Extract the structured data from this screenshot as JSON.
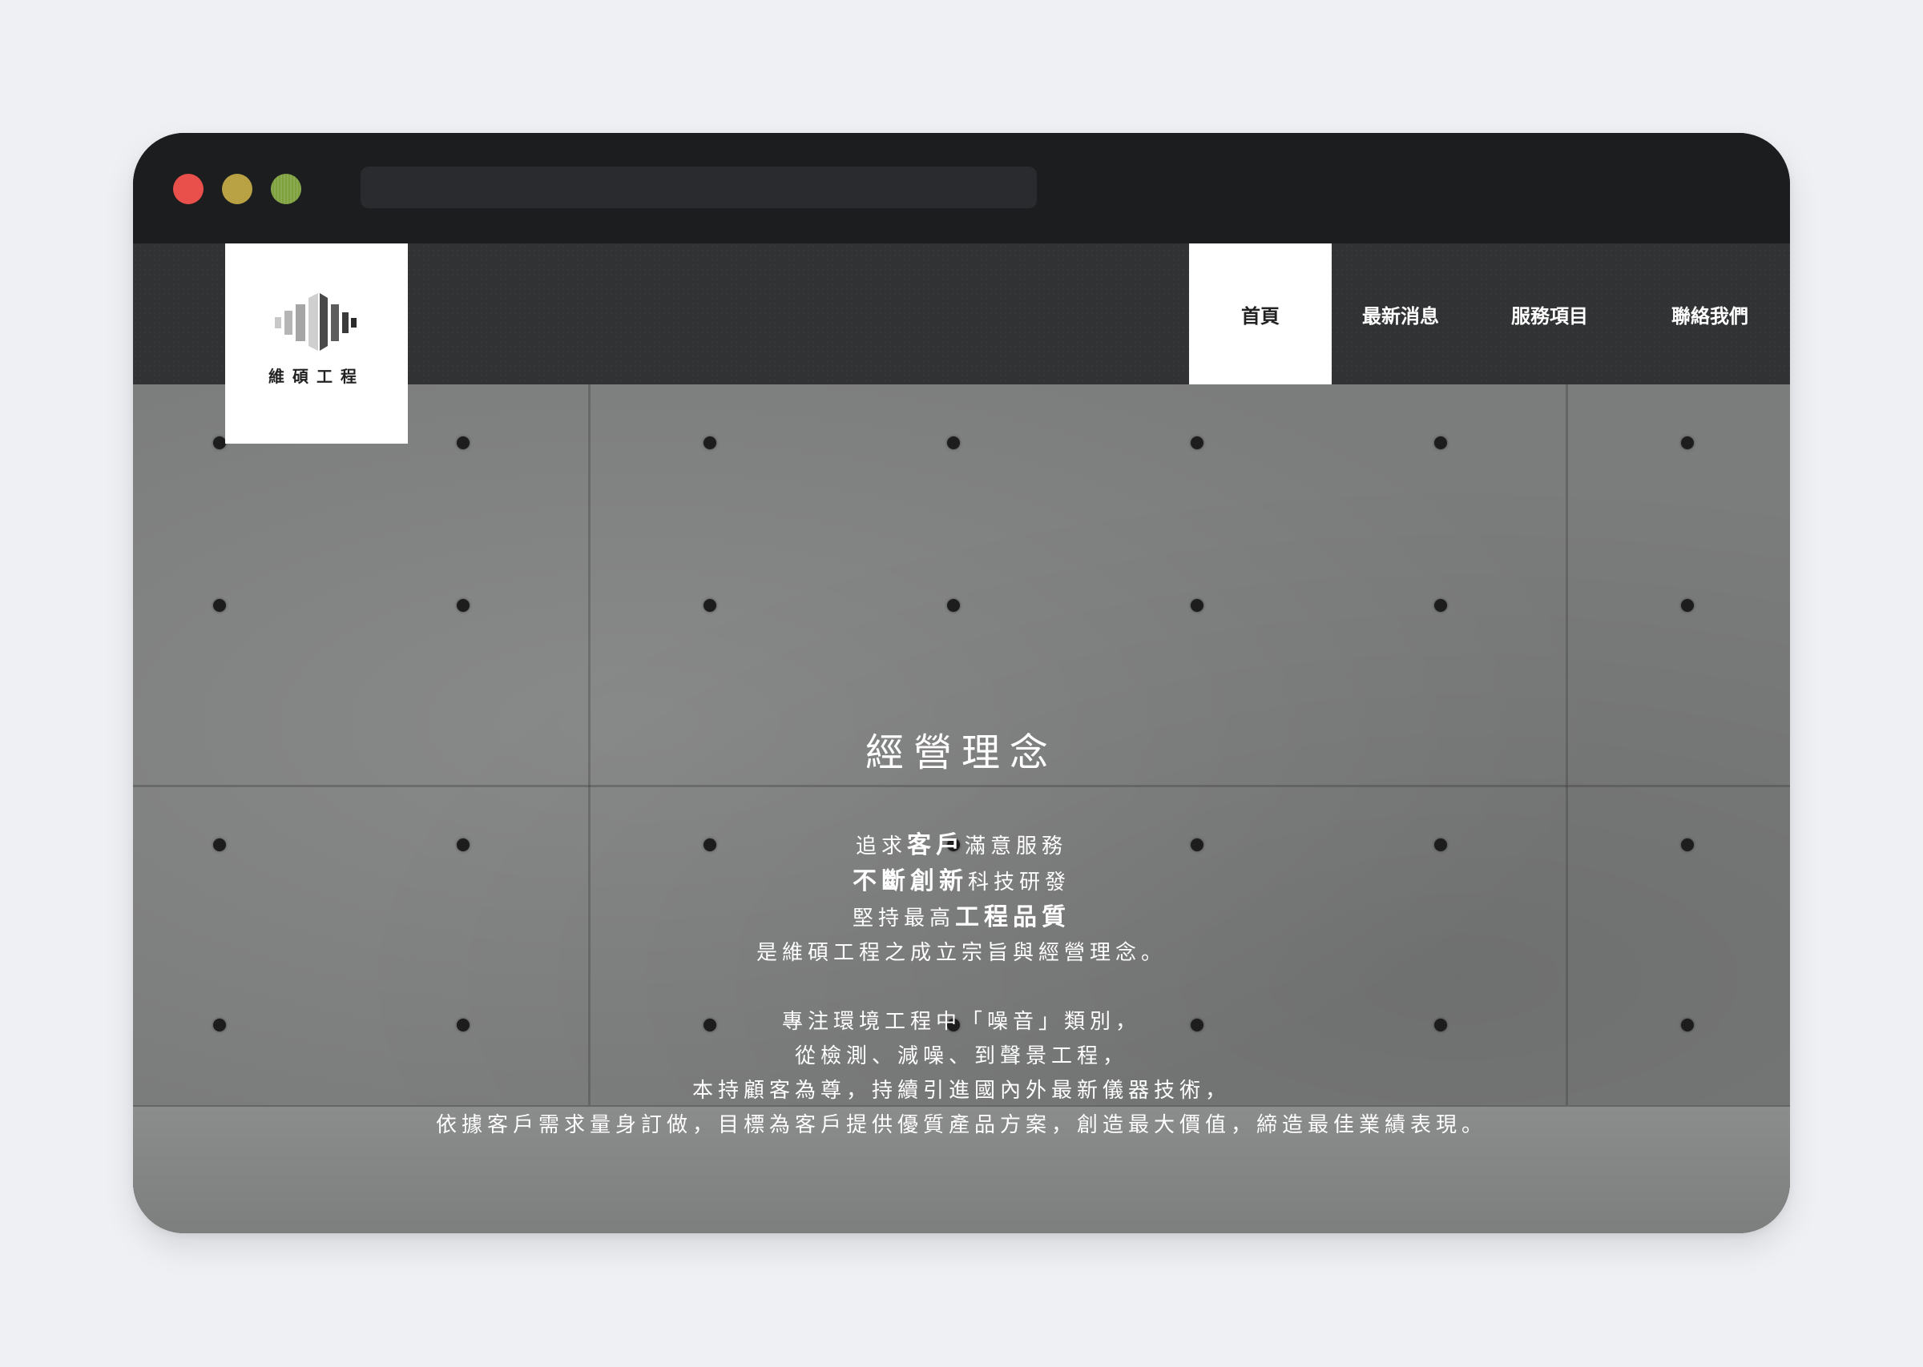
{
  "window": {
    "controls": [
      "close-icon",
      "minimize-icon",
      "maximize-icon"
    ],
    "url": ""
  },
  "logo": {
    "text": "維碩工程",
    "icon": "sound-wave-bars-icon"
  },
  "nav": {
    "items": [
      {
        "label": "首頁",
        "active": true
      },
      {
        "label": "最新消息",
        "active": false
      },
      {
        "label": "服務項目",
        "active": false
      },
      {
        "label": "聯絡我們",
        "active": false
      }
    ]
  },
  "hero": {
    "heading": "經營理念",
    "paragraph1": {
      "line1_a": "追求",
      "line1_b": "客戶",
      "line1_c": "滿意服務",
      "line2_a": "不斷創新",
      "line2_b": "科技研發",
      "line3_a": "堅持最高",
      "line3_b": "工程品質",
      "line4": "是維碩工程之成立宗旨與經營理念。"
    },
    "paragraph2": [
      "專注環境工程中「噪音」類別，",
      "從檢測、減噪、到聲景工程，",
      "本持顧客為尊，持續引進國內外最新儀器技術，",
      "依據客戶需求量身訂做，目標為客戶提供優質產品方案，創造最大價值，締造最佳業績表現。"
    ]
  },
  "carousel": {
    "slide_count": 4,
    "active_index": 0
  },
  "colors": {
    "titlebar": "#1c1d1f",
    "navbar": "#313233",
    "accent_active": "#ffffff",
    "concrete": "#7b7c7c"
  }
}
